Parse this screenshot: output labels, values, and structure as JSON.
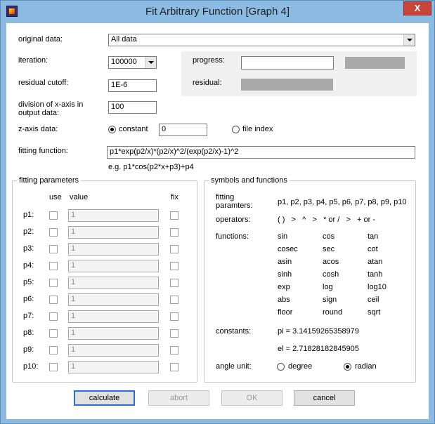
{
  "window": {
    "title": "Fit Arbitrary Function [Graph 4]",
    "close_glyph": "X"
  },
  "original_data": {
    "label": "original data:",
    "value": "All data"
  },
  "iteration": {
    "label": "iteration:",
    "value": "100000"
  },
  "residual_cutoff": {
    "label": "residual cutoff:",
    "value": "1E-6"
  },
  "division": {
    "label_line1": "division of x-axis in",
    "label_line2": "output data:",
    "value": "100"
  },
  "progress": {
    "progress_label": "progress:",
    "residual_label": "residual:"
  },
  "z_axis": {
    "label": "z-axis data:",
    "constant_label": "constant",
    "constant_value": "0",
    "file_index_label": "file index",
    "selected": "constant"
  },
  "fitting_function": {
    "label": "fitting function:",
    "value": "p1*exp(p2/x)*(p2/x)^2/(exp(p2/x)-1)^2",
    "example": "e.g. p1*cos(p2*x+p3)+p4"
  },
  "fitting_parameters": {
    "title": "fitting parameters",
    "col_use": "use",
    "col_value": "value",
    "col_fix": "fix",
    "rows": [
      {
        "name": "p1:",
        "value": "1"
      },
      {
        "name": "p2:",
        "value": "1"
      },
      {
        "name": "p3:",
        "value": "1"
      },
      {
        "name": "p4:",
        "value": "1"
      },
      {
        "name": "p5:",
        "value": "1"
      },
      {
        "name": "p6:",
        "value": "1"
      },
      {
        "name": "p7:",
        "value": "1"
      },
      {
        "name": "p8:",
        "value": "1"
      },
      {
        "name": "p9:",
        "value": "1"
      },
      {
        "name": "p10:",
        "value": "1"
      }
    ]
  },
  "symbols": {
    "title": "symbols and functions",
    "fitting_label_1": "fitting",
    "fitting_label_2": "paramters:",
    "fitting_list": "p1, p2, p3, p4, p5, p6, p7, p8, p9, p10",
    "operators_label": "operators:",
    "operators": "( )   >   ^   >   * or /   >   + or -",
    "functions_label": "functions:",
    "functions": [
      [
        "sin",
        "cos",
        "tan"
      ],
      [
        "cosec",
        "sec",
        "cot"
      ],
      [
        "asin",
        "acos",
        "atan"
      ],
      [
        "sinh",
        "cosh",
        "tanh"
      ],
      [
        "exp",
        "log",
        "log10"
      ],
      [
        "abs",
        "sign",
        "ceil"
      ],
      [
        "floor",
        "round",
        "sqrt"
      ]
    ],
    "constants_label": "constants:",
    "pi": "pi = 3.14159265358979",
    "el": "el = 2.71828182845905",
    "angle_label": "angle unit:",
    "degree_label": "degree",
    "radian_label": "radian",
    "angle_selected": "radian"
  },
  "buttons": {
    "calculate": "calculate",
    "abort": "abort",
    "ok": "OK",
    "cancel": "cancel"
  }
}
